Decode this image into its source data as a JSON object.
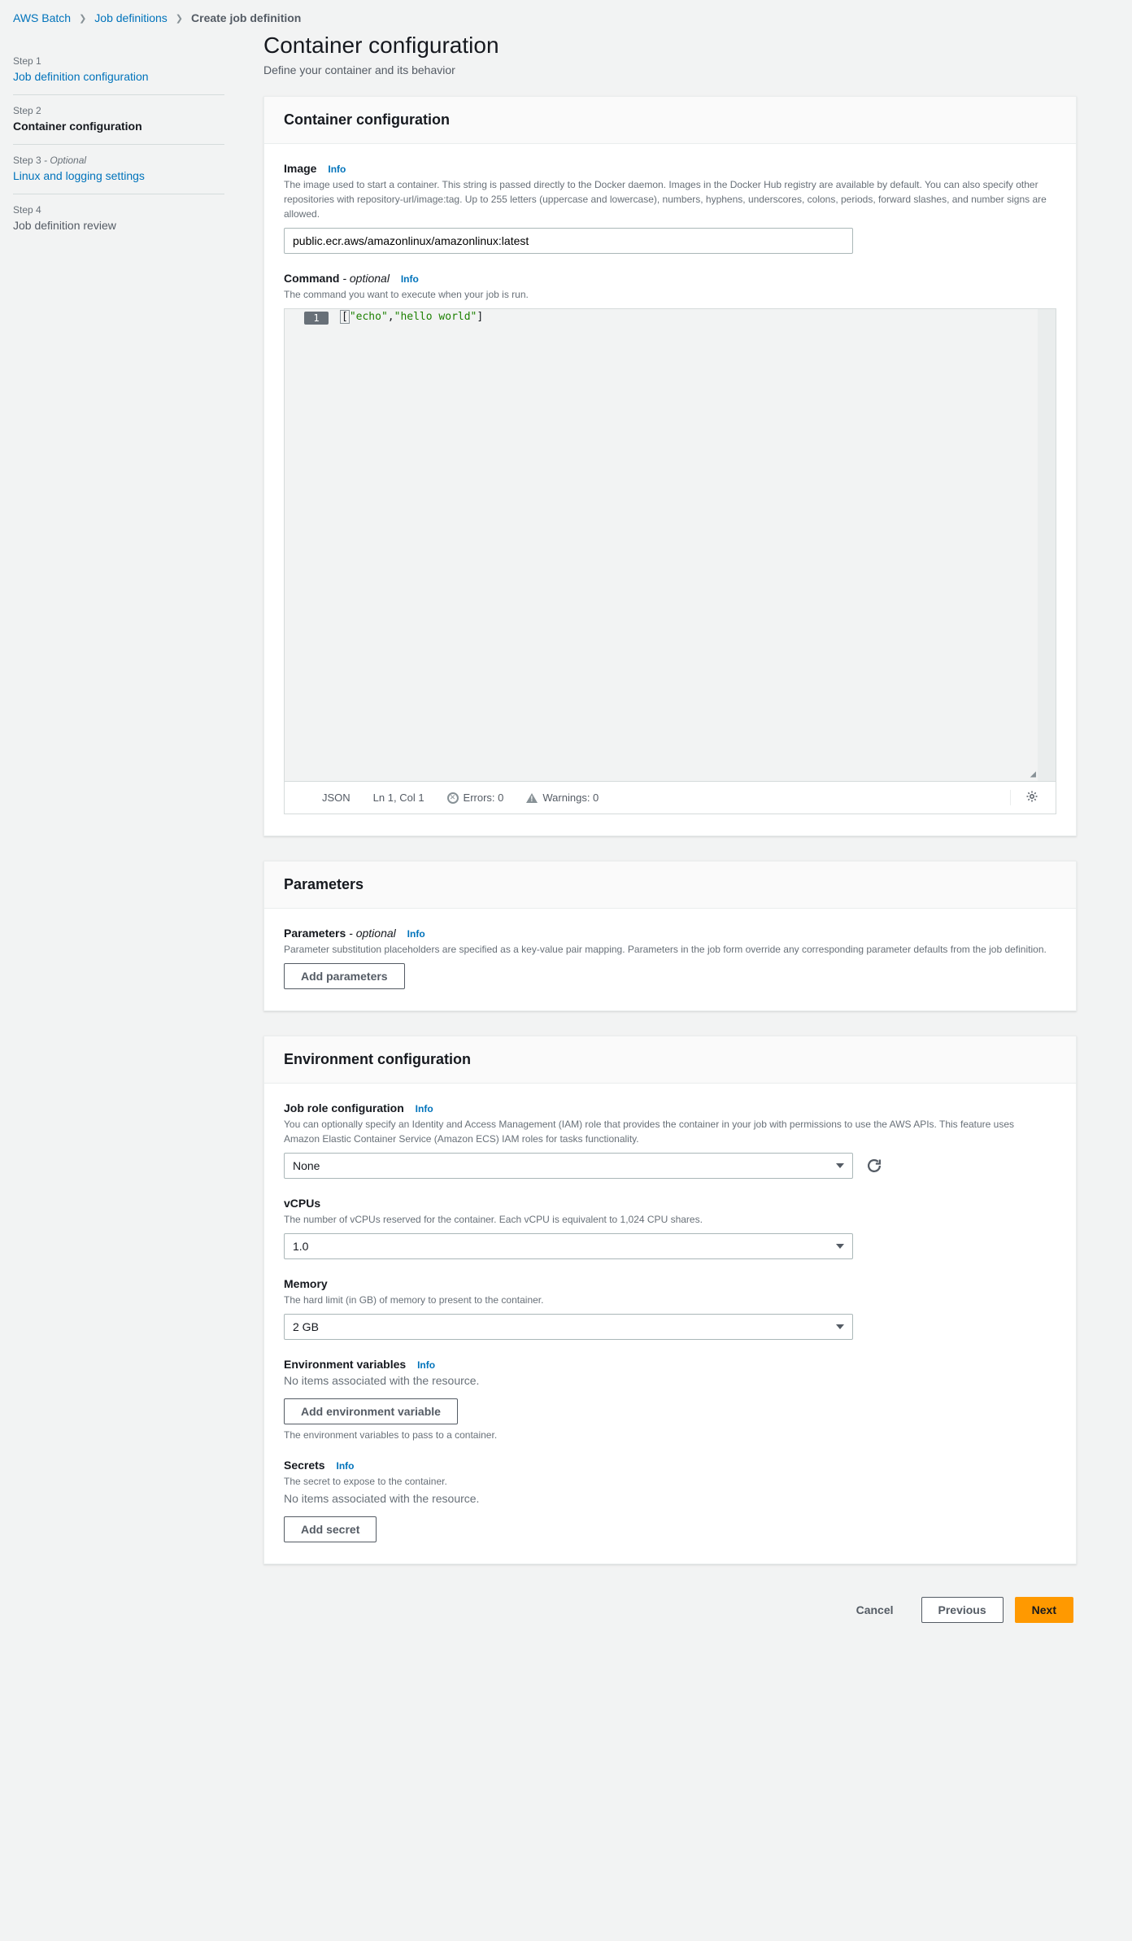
{
  "breadcrumb": {
    "root": "AWS Batch",
    "mid": "Job definitions",
    "current": "Create job definition"
  },
  "sidebar": {
    "steps": [
      {
        "label": "Step 1",
        "title": "Job definition configuration",
        "optional": false
      },
      {
        "label": "Step 2",
        "title": "Container configuration",
        "optional": false
      },
      {
        "label": "Step 3",
        "title": "Linux and logging settings",
        "optional": true
      },
      {
        "label": "Step 4",
        "title": "Job definition review",
        "optional": false
      }
    ],
    "optional_tag": "- Optional"
  },
  "page": {
    "title": "Container configuration",
    "subtitle": "Define your container and its behavior"
  },
  "container": {
    "header": "Container configuration",
    "image": {
      "label": "Image",
      "info": "Info",
      "desc": "The image used to start a container. This string is passed directly to the Docker daemon. Images in the Docker Hub registry are available by default. You can also specify other repositories with repository-url/image:tag. Up to 255 letters (uppercase and lowercase), numbers, hyphens, underscores, colons, periods, forward slashes, and number signs are allowed.",
      "value": "public.ecr.aws/amazonlinux/amazonlinux:latest"
    },
    "command": {
      "label": "Command",
      "optional": "- optional",
      "info": "Info",
      "desc": "The command you want to execute when your job is run.",
      "line_number": "1",
      "value": "[\"echo\",\"hello world\"]",
      "tokens": {
        "open": "[",
        "s1": "\"echo\"",
        "comma": ",",
        "s2": "\"hello world\"",
        "close": "]"
      },
      "status": {
        "mode": "JSON",
        "pos": "Ln 1, Col 1",
        "errors": "Errors: 0",
        "warnings": "Warnings: 0"
      }
    }
  },
  "parameters": {
    "header": "Parameters",
    "label": "Parameters",
    "optional": "- optional",
    "info": "Info",
    "desc": "Parameter substitution placeholders are specified as a key-value pair mapping. Parameters in the job form override any corresponding parameter defaults from the job definition.",
    "add_btn": "Add parameters"
  },
  "env": {
    "header": "Environment configuration",
    "job_role": {
      "label": "Job role configuration",
      "info": "Info",
      "desc": "You can optionally specify an Identity and Access Management (IAM) role that provides the container in your job with permissions to use the AWS APIs. This feature uses Amazon Elastic Container Service (Amazon ECS) IAM roles for tasks functionality.",
      "value": "None"
    },
    "vcpus": {
      "label": "vCPUs",
      "desc": "The number of vCPUs reserved for the container. Each vCPU is equivalent to 1,024 CPU shares.",
      "value": "1.0"
    },
    "memory": {
      "label": "Memory",
      "desc": "The hard limit (in GB) of memory to present to the container.",
      "value": "2 GB"
    },
    "env_vars": {
      "label": "Environment variables",
      "info": "Info",
      "empty": "No items associated with the resource.",
      "add_btn": "Add environment variable",
      "hint": "The environment variables to pass to a container."
    },
    "secrets": {
      "label": "Secrets",
      "info": "Info",
      "desc": "The secret to expose to the container.",
      "empty": "No items associated with the resource.",
      "add_btn": "Add secret"
    }
  },
  "footer": {
    "cancel": "Cancel",
    "previous": "Previous",
    "next": "Next"
  }
}
